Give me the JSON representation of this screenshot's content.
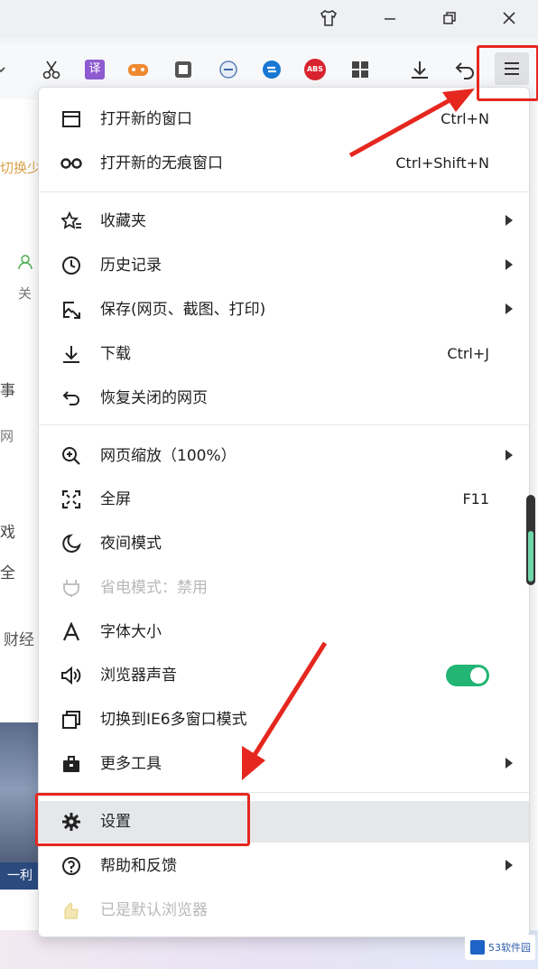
{
  "window_controls": [
    {
      "name": "skin-icon",
      "glyph": "👕"
    },
    {
      "name": "minimize-icon",
      "glyph": "—"
    },
    {
      "name": "restore-icon",
      "glyph": "❐"
    },
    {
      "name": "close-icon",
      "glyph": "✕"
    }
  ],
  "toolbar_icons": [
    "cut-icon",
    "translate-icon",
    "game-icon",
    "reader-icon",
    "zoom-out-icon",
    "sync-icon",
    "adblock-icon",
    "apps-icon",
    "download-icon",
    "undo-icon",
    "menu-icon"
  ],
  "toolbar_glyphs": {
    "translate": "译",
    "adblock": "ABS"
  },
  "page_fragments": {
    "f1": "切换少",
    "f2": "关",
    "f3": "事",
    "f4": "网",
    "f5": "戏",
    "f6": "全",
    "f7": "财经",
    "banner": "一利"
  },
  "menu": {
    "items": [
      {
        "label": "打开新的窗口",
        "shortcut": "Ctrl+N",
        "icon": "window-icon"
      },
      {
        "label": "打开新的无痕窗口",
        "shortcut": "Ctrl+Shift+N",
        "icon": "incognito-icon"
      },
      {
        "label": "收藏夹",
        "icon": "favorites-icon",
        "submenu": true
      },
      {
        "label": "历史记录",
        "icon": "history-icon",
        "submenu": true
      },
      {
        "label": "保存(网页、截图、打印)",
        "icon": "save-icon",
        "submenu": true
      },
      {
        "label": "下载",
        "shortcut": "Ctrl+J",
        "icon": "download-icon"
      },
      {
        "label": "恢复关闭的网页",
        "icon": "restore-page-icon"
      },
      {
        "label": "网页缩放（100%）",
        "icon": "zoom-icon",
        "submenu": true
      },
      {
        "label": "全屏",
        "shortcut": "F11",
        "icon": "fullscreen-icon"
      },
      {
        "label": "夜间模式",
        "icon": "night-mode-icon"
      },
      {
        "label": "省电模式：禁用",
        "icon": "power-save-icon",
        "disabled": true
      },
      {
        "label": "字体大小",
        "icon": "font-size-icon"
      },
      {
        "label": "浏览器声音",
        "icon": "sound-icon",
        "toggle": true
      },
      {
        "label": "切换到IE6多窗口模式",
        "icon": "ie6-window-icon"
      },
      {
        "label": "更多工具",
        "icon": "tools-icon",
        "submenu": true
      },
      {
        "label": "设置",
        "icon": "settings-icon"
      },
      {
        "label": "帮助和反馈",
        "icon": "help-icon",
        "submenu": true
      },
      {
        "label": "已是默认浏览器",
        "icon": "default-browser-icon",
        "disabled": true
      }
    ]
  },
  "watermark": "53软件园",
  "colors": {
    "accent_red": "#e5271f",
    "toggle_on": "#22b573"
  }
}
